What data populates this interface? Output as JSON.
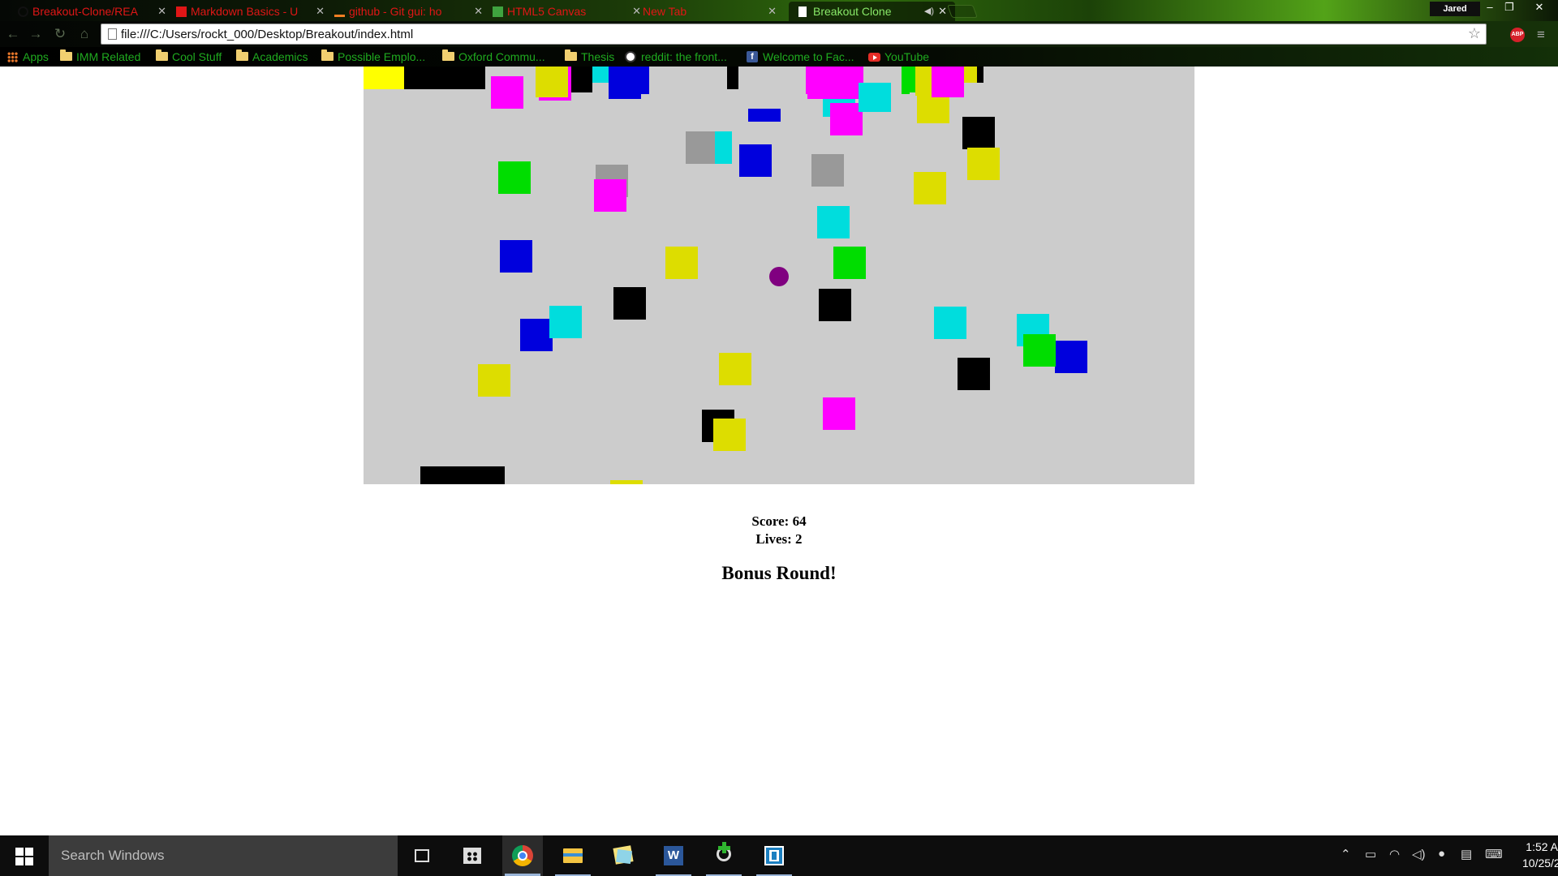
{
  "browser": {
    "tabs": [
      {
        "title": "Breakout-Clone/REA",
        "icon": "github-icon"
      },
      {
        "title": "Markdown Basics - U",
        "icon": "markdown-icon"
      },
      {
        "title": "github - Git gui: ho",
        "icon": "stackoverflow-icon"
      },
      {
        "title": "HTML5 Canvas",
        "icon": "html5-icon"
      },
      {
        "title": "New Tab",
        "icon": "none"
      },
      {
        "title": "Breakout Clone",
        "icon": "page-icon",
        "active": true
      }
    ],
    "profile_name": "Jared",
    "url": "file:///C:/Users/rockt_000/Desktop/Breakout/index.html",
    "bookmarks": [
      {
        "label": "Apps",
        "icon": "apps-icon"
      },
      {
        "label": "IMM Related",
        "icon": "folder-icon"
      },
      {
        "label": "Cool Stuff",
        "icon": "folder-icon"
      },
      {
        "label": "Academics",
        "icon": "folder-icon"
      },
      {
        "label": "Possible Emplo...",
        "icon": "folder-icon"
      },
      {
        "label": "Oxford Commu...",
        "icon": "folder-icon"
      },
      {
        "label": "Thesis",
        "icon": "folder-icon"
      },
      {
        "label": "reddit: the front...",
        "icon": "reddit-icon"
      },
      {
        "label": "Welcome to Fac...",
        "icon": "facebook-icon"
      },
      {
        "label": "YouTube",
        "icon": "youtube-icon"
      }
    ]
  },
  "game": {
    "canvas_background": "#cccccc",
    "ball_color": "#800080",
    "paddle_color": "#000000",
    "brick_colors": [
      "#ff00ff",
      "#00dddd",
      "#0000dd",
      "#00dd00",
      "#dddd00",
      "#000000",
      "#999999"
    ],
    "score_label": "Score: 64",
    "lives_label": "Lives: 2",
    "bonus_label": "Bonus Round!"
  },
  "taskbar": {
    "search_placeholder": "Search Windows",
    "apps": [
      "task-view-icon",
      "store-icon",
      "chrome-icon",
      "file-explorer-icon",
      "sticky-notes-icon",
      "word-icon",
      "greenshot-icon",
      "brackets-icon"
    ],
    "clock_time": "1:52 A",
    "clock_date": "10/25/2"
  }
}
